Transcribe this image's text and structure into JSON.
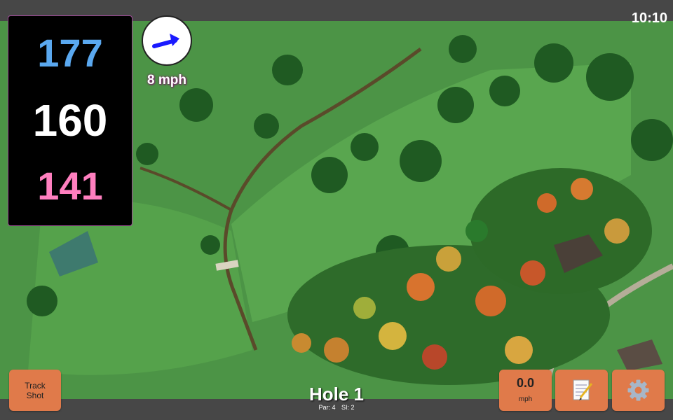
{
  "status": {
    "time": "10:10"
  },
  "distances": {
    "back": "177",
    "middle": "160",
    "front": "141"
  },
  "wind": {
    "speed": "8 mph",
    "icon": "wind-arrow-icon",
    "direction_color": "#1a1aff"
  },
  "buttons": {
    "track_shot": "Track\nShot",
    "speed_value": "0.0",
    "speed_unit": "mph",
    "notes_icon": "notepad-icon",
    "settings_icon": "gear-icon"
  },
  "hole": {
    "title": "Hole 1",
    "par": "Par: 4",
    "si": "SI: 2"
  },
  "colors": {
    "back": "#5aa8ef",
    "middle": "#ffffff",
    "front": "#ff7fbf",
    "button": "#e07a4a",
    "panel_border": "#a34c9c"
  }
}
